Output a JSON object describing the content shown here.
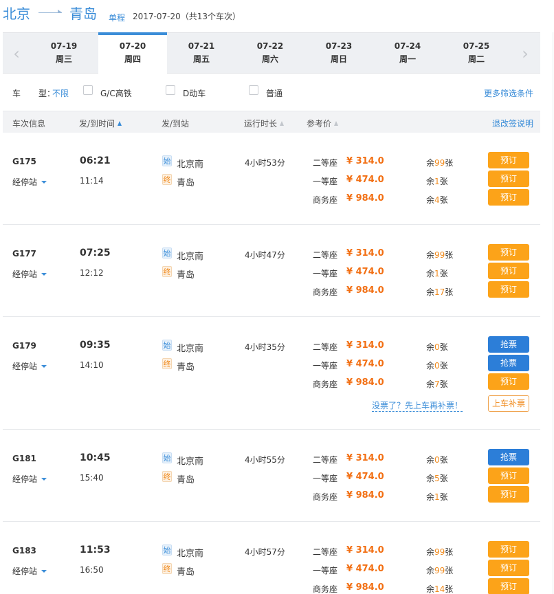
{
  "header": {
    "from": "北京",
    "to": "青岛",
    "trip_type": "单程",
    "date_summary": "2017-07-20（共13个车次）"
  },
  "dates": [
    {
      "md": "07-19",
      "wd": "周三",
      "active": false
    },
    {
      "md": "07-20",
      "wd": "周四",
      "active": true
    },
    {
      "md": "07-21",
      "wd": "周五",
      "active": false
    },
    {
      "md": "07-22",
      "wd": "周六",
      "active": false
    },
    {
      "md": "07-23",
      "wd": "周日",
      "active": false
    },
    {
      "md": "07-24",
      "wd": "周一",
      "active": false
    },
    {
      "md": "07-25",
      "wd": "周二",
      "active": false
    }
  ],
  "filter": {
    "label_a": "车",
    "label_b": "型：",
    "all": "不限",
    "options": [
      "G/C高铁",
      "D动车",
      "普通"
    ],
    "more": "更多筛选条件"
  },
  "columns": {
    "train": "车次信息",
    "time": "发/到时间",
    "station": "发/到站",
    "duration": "运行时长",
    "price": "参考价",
    "rule": "退改签说明"
  },
  "labels": {
    "stops": "经停站",
    "start_tag": "始",
    "end_tag": "终",
    "book": "预订",
    "grab": "抢票",
    "makeup": "没票了？先上车再补票！",
    "board": "上车补票"
  },
  "trains": [
    {
      "no": "G175",
      "dep": "06:21",
      "arr": "11:14",
      "from": "北京南",
      "to": "青岛",
      "duration": "4小时53分",
      "seats": [
        {
          "name": "二等座",
          "price": "¥ 314.0",
          "left_pre": "余",
          "left_n": "99",
          "left_post": "张",
          "action": "book"
        },
        {
          "name": "一等座",
          "price": "¥ 474.0",
          "left_pre": "余",
          "left_n": "1",
          "left_post": "张",
          "action": "book"
        },
        {
          "name": "商务座",
          "price": "¥ 984.0",
          "left_pre": "余",
          "left_n": "4",
          "left_post": "张",
          "action": "book"
        }
      ]
    },
    {
      "no": "G177",
      "dep": "07:25",
      "arr": "12:12",
      "from": "北京南",
      "to": "青岛",
      "duration": "4小时47分",
      "seats": [
        {
          "name": "二等座",
          "price": "¥ 314.0",
          "left_pre": "余",
          "left_n": "99",
          "left_post": "张",
          "action": "book"
        },
        {
          "name": "一等座",
          "price": "¥ 474.0",
          "left_pre": "余",
          "left_n": "1",
          "left_post": "张",
          "action": "book"
        },
        {
          "name": "商务座",
          "price": "¥ 984.0",
          "left_pre": "余",
          "left_n": "17",
          "left_post": "张",
          "action": "book"
        }
      ]
    },
    {
      "no": "G179",
      "dep": "09:35",
      "arr": "14:10",
      "from": "北京南",
      "to": "青岛",
      "duration": "4小时35分",
      "seats": [
        {
          "name": "二等座",
          "price": "¥ 314.0",
          "left_pre": "余",
          "left_n": "0",
          "left_post": "张",
          "action": "grab"
        },
        {
          "name": "一等座",
          "price": "¥ 474.0",
          "left_pre": "余",
          "left_n": "0",
          "left_post": "张",
          "action": "grab"
        },
        {
          "name": "商务座",
          "price": "¥ 984.0",
          "left_pre": "余",
          "left_n": "7",
          "left_post": "张",
          "action": "book"
        }
      ],
      "makeup": true
    },
    {
      "no": "G181",
      "dep": "10:45",
      "arr": "15:40",
      "from": "北京南",
      "to": "青岛",
      "duration": "4小时55分",
      "seats": [
        {
          "name": "二等座",
          "price": "¥ 314.0",
          "left_pre": "余",
          "left_n": "0",
          "left_post": "张",
          "action": "grab"
        },
        {
          "name": "一等座",
          "price": "¥ 474.0",
          "left_pre": "余",
          "left_n": "5",
          "left_post": "张",
          "action": "book"
        },
        {
          "name": "商务座",
          "price": "¥ 984.0",
          "left_pre": "余",
          "left_n": "1",
          "left_post": "张",
          "action": "book"
        }
      ]
    },
    {
      "no": "G183",
      "dep": "11:53",
      "arr": "16:50",
      "from": "北京南",
      "to": "青岛",
      "duration": "4小时57分",
      "seats": [
        {
          "name": "二等座",
          "price": "¥ 314.0",
          "left_pre": "余",
          "left_n": "99",
          "left_post": "张",
          "action": "book"
        },
        {
          "name": "一等座",
          "price": "¥ 474.0",
          "left_pre": "余",
          "left_n": "99",
          "left_post": "张",
          "action": "book"
        },
        {
          "name": "商务座",
          "price": "¥ 984.0",
          "left_pre": "余",
          "left_n": "14",
          "left_post": "张",
          "action": "book"
        }
      ]
    }
  ],
  "colors": {
    "accent": "#3b8dd8",
    "price": "#f26f13",
    "book": "#fca319",
    "grab": "#2c7ed8"
  }
}
